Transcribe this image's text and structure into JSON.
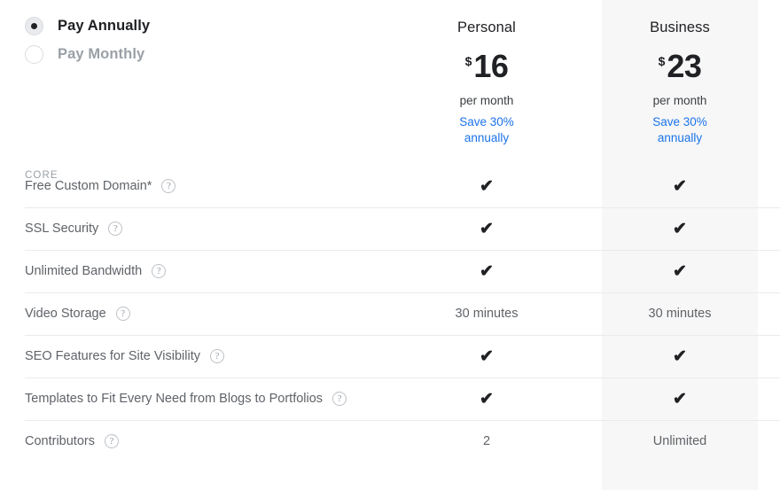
{
  "billing_toggle": {
    "options": [
      {
        "label": "Pay Annually",
        "selected": true
      },
      {
        "label": "Pay Monthly",
        "selected": false
      }
    ]
  },
  "plans": [
    {
      "name": "Personal",
      "currency": "$",
      "amount": "16",
      "period": "per month",
      "save_line1": "Save 30%",
      "save_line2": "annually",
      "highlighted": false
    },
    {
      "name": "Business",
      "currency": "$",
      "amount": "23",
      "period": "per month",
      "save_line1": "Save 30%",
      "save_line2": "annually",
      "highlighted": true
    }
  ],
  "section": {
    "label": "CORE"
  },
  "help_glyph": "?",
  "check_glyph": "✔",
  "features": [
    {
      "name": "Free Custom Domain*",
      "help": true,
      "personal": {
        "type": "check"
      },
      "business": {
        "type": "check"
      }
    },
    {
      "name": "SSL Security",
      "help": true,
      "personal": {
        "type": "check"
      },
      "business": {
        "type": "check"
      }
    },
    {
      "name": "Unlimited Bandwidth",
      "help": true,
      "personal": {
        "type": "check"
      },
      "business": {
        "type": "check"
      }
    },
    {
      "name": "Video Storage",
      "help": true,
      "personal": {
        "type": "text",
        "value": "30 minutes"
      },
      "business": {
        "type": "text",
        "value": "30 minutes"
      }
    },
    {
      "name": "SEO Features for Site Visibility",
      "help": true,
      "personal": {
        "type": "check"
      },
      "business": {
        "type": "check"
      }
    },
    {
      "name": "Templates to Fit Every Need from Blogs to Portfolios",
      "help": true,
      "personal": {
        "type": "check"
      },
      "business": {
        "type": "check"
      }
    },
    {
      "name": "Contributors",
      "help": true,
      "personal": {
        "type": "text",
        "value": "2"
      },
      "business": {
        "type": "text",
        "value": "Unlimited"
      }
    }
  ],
  "colors": {
    "accent_link": "#1a73e8",
    "highlight_column": "#f7f7f7",
    "divider": "#ebebeb",
    "text_primary": "#202124",
    "text_secondary": "#5f6368",
    "text_muted": "#9aa0a6"
  }
}
